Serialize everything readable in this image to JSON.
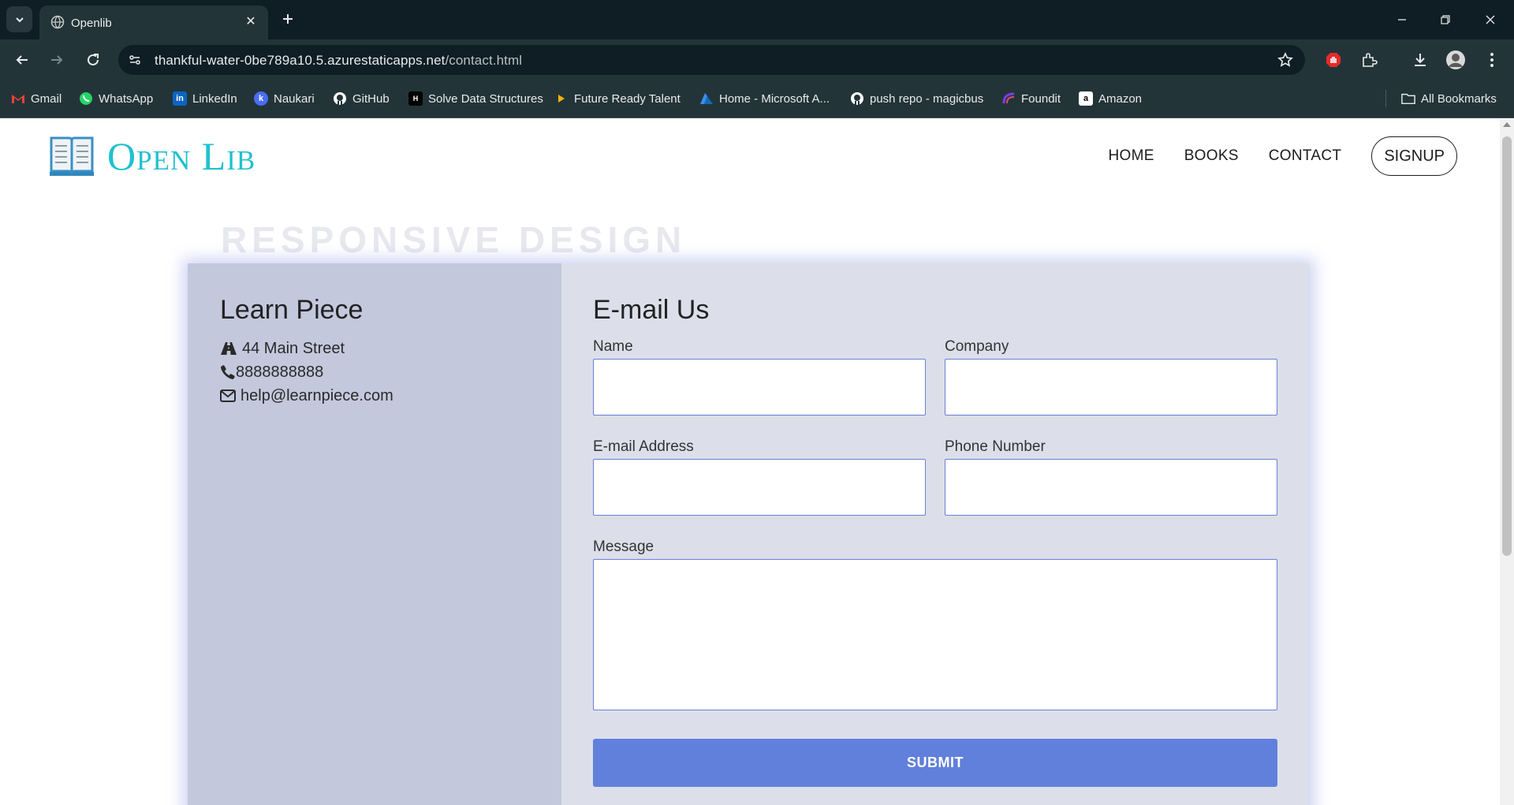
{
  "browser": {
    "tab_title": "Openlib",
    "url_host": "thankful-water-0be789a10.5.azurestaticapps.net",
    "url_path": "/contact.html",
    "bookmarks": [
      {
        "label": "Gmail",
        "icon": "gmail-icon",
        "color": "#ea4335"
      },
      {
        "label": "WhatsApp",
        "icon": "whatsapp-icon",
        "color": "#25d366"
      },
      {
        "label": "LinkedIn",
        "icon": "linkedin-icon",
        "color": "#0a66c2"
      },
      {
        "label": "Naukari",
        "icon": "naukri-icon",
        "color": "#4a6cf7"
      },
      {
        "label": "GitHub",
        "icon": "github-icon",
        "color": "#ffffff"
      },
      {
        "label": "Solve Data Structures",
        "icon": "hackerrank-icon",
        "color": "#1ba94c"
      },
      {
        "label": "Future Ready Talent",
        "icon": "play-icon",
        "color": "#f4b400"
      },
      {
        "label": "Home - Microsoft A...",
        "icon": "azure-icon",
        "color": "#3b8eea"
      },
      {
        "label": "push repo - magicbus",
        "icon": "github-icon",
        "color": "#ffffff"
      },
      {
        "label": "Foundit",
        "icon": "foundit-icon",
        "color": "#7b3fe4"
      },
      {
        "label": "Amazon",
        "icon": "amazon-icon",
        "color": "#ffffff"
      }
    ],
    "all_bookmarks_label": "All Bookmarks"
  },
  "site": {
    "logo_text": "Open Lib",
    "brand_color": "#1ec1cf",
    "nav": {
      "home": "HOME",
      "books": "BOOKS",
      "contact": "CONTACT",
      "signup": "SIGNUP"
    }
  },
  "contact": {
    "faded_heading": "RESPONSIVE DESIGN",
    "org_name": "Learn Piece",
    "address": "44 Main Street",
    "phone": "8888888888",
    "email": "help@learnpiece.com",
    "form_title": "E-mail Us",
    "fields": {
      "name": {
        "label": "Name",
        "value": ""
      },
      "company": {
        "label": "Company",
        "value": ""
      },
      "email": {
        "label": "E-mail Address",
        "value": ""
      },
      "phone": {
        "label": "Phone Number",
        "value": ""
      },
      "message": {
        "label": "Message",
        "value": ""
      }
    },
    "submit_label": "SUBMIT",
    "accent_color": "#6180db"
  }
}
